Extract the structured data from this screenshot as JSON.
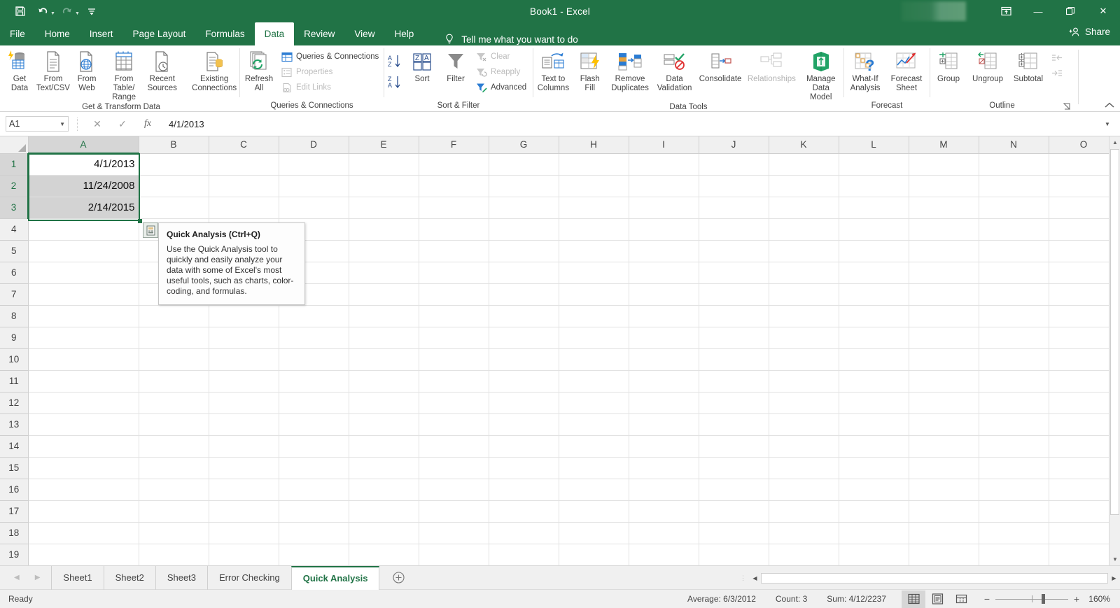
{
  "window": {
    "title": "Book1  -  Excel",
    "qat": [
      {
        "name": "save",
        "icon": "save-icon"
      },
      {
        "name": "undo",
        "icon": "undo-icon"
      },
      {
        "name": "redo",
        "icon": "redo-icon"
      },
      {
        "name": "customize",
        "icon": "customize-quick-access-toolbar-icon"
      }
    ],
    "controls": {
      "ribbon_display_options": "ribbon-display-options-icon",
      "minimize": "—",
      "restore": "❐",
      "close": "✕"
    }
  },
  "ribbon_tabs": [
    {
      "label": "File",
      "active": false
    },
    {
      "label": "Home",
      "active": false
    },
    {
      "label": "Insert",
      "active": false
    },
    {
      "label": "Page Layout",
      "active": false
    },
    {
      "label": "Formulas",
      "active": false
    },
    {
      "label": "Data",
      "active": true
    },
    {
      "label": "Review",
      "active": false
    },
    {
      "label": "View",
      "active": false
    },
    {
      "label": "Help",
      "active": false
    }
  ],
  "tellme": {
    "label": "Tell me what you want to do"
  },
  "share": {
    "label": "Share"
  },
  "ribbon_groups": [
    {
      "name": "Get & Transform Data",
      "label": "Get & Transform Data",
      "buttons": [
        {
          "label": "Get\nData",
          "dropdown": true,
          "icon": "get-data-icon",
          "disabled": false
        },
        {
          "label": "From\nText/CSV",
          "dropdown": false,
          "icon": "from-text-csv-icon",
          "disabled": false
        },
        {
          "label": "From\nWeb",
          "dropdown": false,
          "icon": "from-web-icon",
          "disabled": false
        },
        {
          "label": "From Table/\nRange",
          "dropdown": false,
          "icon": "from-table-range-icon",
          "disabled": false
        },
        {
          "label": "Recent\nSources",
          "dropdown": false,
          "icon": "recent-sources-icon",
          "disabled": false
        },
        {
          "label": "Existing\nConnections",
          "dropdown": false,
          "icon": "existing-connections-icon",
          "disabled": false
        }
      ]
    },
    {
      "name": "Queries & Connections",
      "label": "Queries & Connections",
      "buttons": [
        {
          "label": "Refresh\nAll",
          "dropdown": true,
          "icon": "refresh-all-icon",
          "disabled": false
        }
      ],
      "small": [
        {
          "label": "Queries & Connections",
          "icon": "queries-connections-icon",
          "disabled": false
        },
        {
          "label": "Properties",
          "icon": "properties-icon",
          "disabled": true
        },
        {
          "label": "Edit Links",
          "icon": "edit-links-icon",
          "disabled": true
        }
      ]
    },
    {
      "name": "Sort & Filter",
      "label": "Sort & Filter",
      "buttons": [
        {
          "label": "Sort",
          "dropdown": false,
          "icon": "sort-icon",
          "disabled": false
        },
        {
          "label": "Filter",
          "dropdown": false,
          "icon": "filter-icon",
          "disabled": false
        }
      ],
      "small": [
        {
          "label": "Clear",
          "icon": "clear-filter-icon",
          "disabled": true
        },
        {
          "label": "Reapply",
          "icon": "reapply-filter-icon",
          "disabled": true
        },
        {
          "label": "Advanced",
          "icon": "advanced-filter-icon",
          "disabled": false
        }
      ],
      "sort_az": "sort-ascending-icon",
      "sort_za": "sort-descending-icon"
    },
    {
      "name": "Data Tools",
      "label": "Data Tools",
      "buttons": [
        {
          "label": "Text to\nColumns",
          "dropdown": false,
          "icon": "text-to-columns-icon",
          "disabled": false
        },
        {
          "label": "Flash\nFill",
          "dropdown": false,
          "icon": "flash-fill-icon",
          "disabled": false
        },
        {
          "label": "Remove\nDuplicates",
          "dropdown": false,
          "icon": "remove-duplicates-icon",
          "disabled": false
        },
        {
          "label": "Data\nValidation",
          "dropdown": true,
          "icon": "data-validation-icon",
          "disabled": false
        },
        {
          "label": "Consolidate",
          "dropdown": false,
          "icon": "consolidate-icon",
          "disabled": false
        },
        {
          "label": "Relationships",
          "dropdown": false,
          "icon": "relationships-icon",
          "disabled": true
        },
        {
          "label": "Manage\nData Model",
          "dropdown": false,
          "icon": "manage-data-model-icon",
          "disabled": false
        }
      ]
    },
    {
      "name": "Forecast",
      "label": "Forecast",
      "buttons": [
        {
          "label": "What-If\nAnalysis",
          "dropdown": true,
          "icon": "what-if-analysis-icon",
          "disabled": false
        },
        {
          "label": "Forecast\nSheet",
          "dropdown": false,
          "icon": "forecast-sheet-icon",
          "disabled": false
        }
      ]
    },
    {
      "name": "Outline",
      "label": "Outline",
      "buttons": [
        {
          "label": "Group",
          "dropdown": true,
          "icon": "group-icon",
          "disabled": false
        },
        {
          "label": "Ungroup",
          "dropdown": true,
          "icon": "ungroup-icon",
          "disabled": false
        },
        {
          "label": "Subtotal",
          "dropdown": false,
          "icon": "subtotal-icon",
          "disabled": false
        }
      ],
      "small": [
        {
          "label": "",
          "icon": "show-detail-icon",
          "disabled": true
        },
        {
          "label": "",
          "icon": "hide-detail-icon",
          "disabled": true
        }
      ]
    }
  ],
  "formula_bar": {
    "name_box": "A1",
    "cancel_icon": "cancel-icon",
    "enter_icon": "enter-icon",
    "function_icon": "insert-function-icon",
    "value": "4/1/2013",
    "expand_icon": "expand-formula-bar-icon"
  },
  "grid": {
    "columns": [
      "A",
      "B",
      "C",
      "D",
      "E",
      "F",
      "G",
      "H",
      "I",
      "J",
      "K",
      "L",
      "M",
      "N",
      "O"
    ],
    "rows": [
      "1",
      "2",
      "3",
      "4",
      "5",
      "6",
      "7",
      "8",
      "9",
      "10",
      "11",
      "12",
      "13",
      "14",
      "15",
      "16",
      "17",
      "18",
      "19"
    ],
    "selected_columns": [
      "A"
    ],
    "selected_rows": [
      "1",
      "2",
      "3"
    ],
    "cells": [
      {
        "ref": "A1",
        "value": "4/1/2013"
      },
      {
        "ref": "A2",
        "value": "11/24/2008"
      },
      {
        "ref": "A3",
        "value": "2/14/2015"
      }
    ],
    "active_cell": "A1",
    "selection_range": "A1:A3"
  },
  "quick_analysis": {
    "button_icon": "quick-analysis-icon",
    "tooltip_title": "Quick Analysis (Ctrl+Q)",
    "tooltip_body": "Use the Quick Analysis tool to quickly and easily analyze your data with some of Excel's most useful tools, such as charts, color-coding, and formulas."
  },
  "sheet_tabs": {
    "prev_icon": "previous-sheet-icon",
    "next_icon": "next-sheet-icon",
    "tabs": [
      {
        "label": "Sheet1",
        "active": false
      },
      {
        "label": "Sheet2",
        "active": false
      },
      {
        "label": "Sheet3",
        "active": false
      },
      {
        "label": "Error Checking",
        "active": false
      },
      {
        "label": "Quick Analysis",
        "active": true
      }
    ],
    "add_sheet_icon": "add-sheet-icon"
  },
  "status_bar": {
    "mode": "Ready",
    "average": "Average: 6/3/2012",
    "count": "Count: 3",
    "sum": "Sum: 4/12/2237",
    "views": [
      {
        "name": "normal-view",
        "active": true
      },
      {
        "name": "page-layout-view",
        "active": false
      },
      {
        "name": "page-break-preview",
        "active": false
      }
    ],
    "zoom_out_label": "−",
    "zoom_in_label": "+",
    "zoom_level": "160%",
    "zoom_percent": 160
  },
  "colors": {
    "brand_green": "#217346",
    "selection_green": "#217346",
    "header_gray": "#f0f0f0",
    "selected_header": "#d6d6d6",
    "shaded_cell": "#d3d3d3"
  }
}
